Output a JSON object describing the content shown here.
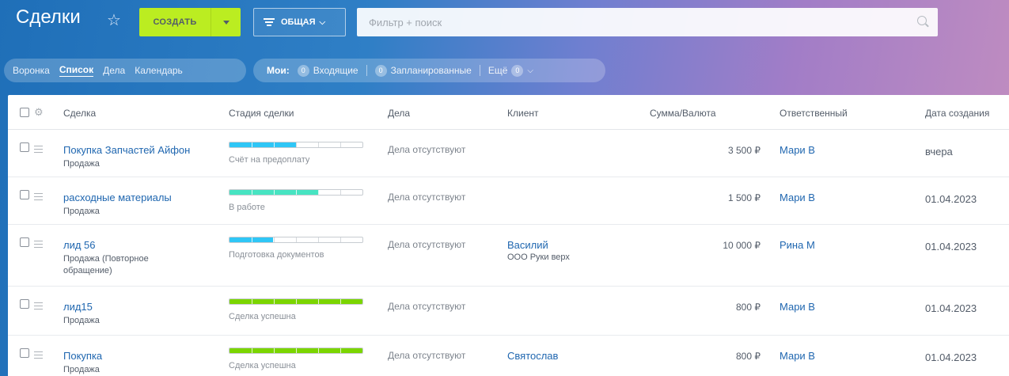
{
  "header": {
    "title": "Сделки",
    "create_label": "СОЗДАТЬ",
    "general_label": "ОБЩАЯ",
    "search_placeholder": "Фильтр + поиск"
  },
  "views": [
    {
      "label": "Воронка",
      "active": false
    },
    {
      "label": "Список",
      "active": true
    },
    {
      "label": "Дела",
      "active": false
    },
    {
      "label": "Календарь",
      "active": false
    }
  ],
  "counters": {
    "mine_label": "Мои:",
    "incoming_count": "0",
    "incoming_label": "Входящие",
    "planned_count": "0",
    "planned_label": "Запланированные",
    "more_label": "Ещё",
    "more_count": "0"
  },
  "table": {
    "headers": {
      "deal": "Сделка",
      "stage": "Стадия сделки",
      "tasks": "Дела",
      "client": "Клиент",
      "sum": "Сумма/Валюта",
      "responsible": "Ответственный",
      "created": "Дата создания"
    },
    "rows": [
      {
        "title": "Покупка Запчастей Айфон",
        "type": "Продажа",
        "stage": "Счёт на предоплату",
        "progress": 0.5,
        "stage_color": "#2fc6f6",
        "tasks": "Дела отсутствуют",
        "client": "",
        "company": "",
        "sum": "3 500 ₽",
        "responsible": "Мари В",
        "created": "вчера"
      },
      {
        "title": "расходные материалы",
        "type": "Продажа",
        "stage": "В работе",
        "progress": 0.67,
        "stage_color": "#47e4c2",
        "tasks": "Дела отсутствуют",
        "client": "",
        "company": "",
        "sum": "1 500 ₽",
        "responsible": "Мари В",
        "created": "01.04.2023"
      },
      {
        "title": "лид 56",
        "type": "Продажа (Повторное обращение)",
        "stage": "Подготовка документов",
        "progress": 0.33,
        "stage_color": "#2fc6f6",
        "tasks": "Дела отсутствуют",
        "client": "Василий",
        "company": "ООО Руки верх",
        "sum": "10 000 ₽",
        "responsible": "Рина М",
        "created": "01.04.2023"
      },
      {
        "title": "лид15",
        "type": "Продажа",
        "stage": "Сделка успешна",
        "progress": 1.0,
        "stage_color": "#7bd500",
        "tasks": "Дела отсутствуют",
        "client": "",
        "company": "",
        "sum": "800 ₽",
        "responsible": "Мари В",
        "created": "01.04.2023"
      },
      {
        "title": "Покупка",
        "type": "Продажа",
        "stage": "Сделка успешна",
        "progress": 1.0,
        "stage_color": "#7bd500",
        "tasks": "Дела отсутствуют",
        "client": "Святослав",
        "company": "",
        "sum": "800 ₽",
        "responsible": "Мари В",
        "created": "01.04.2023"
      }
    ]
  }
}
